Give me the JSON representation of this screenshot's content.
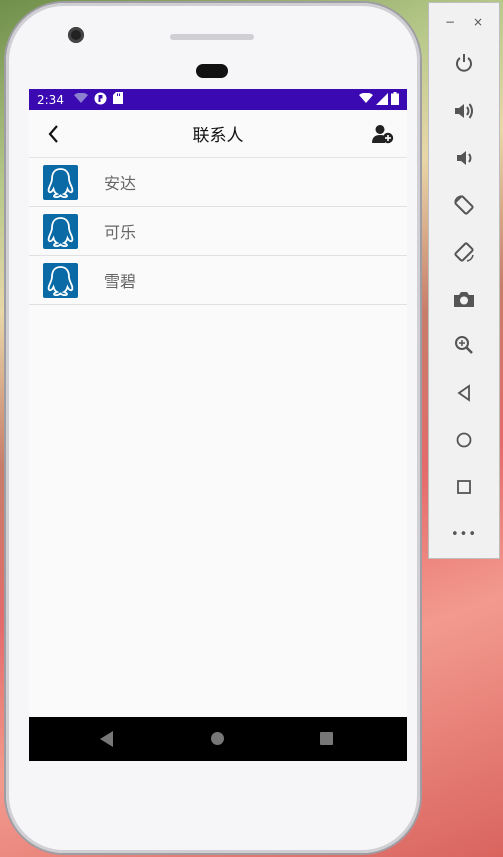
{
  "status_bar": {
    "time": "2:34"
  },
  "toolbar": {
    "title": "联系人"
  },
  "contacts": [
    {
      "name": "安达"
    },
    {
      "name": "可乐"
    },
    {
      "name": "雪碧"
    }
  ],
  "emulator_panel": {
    "minimize_label": "−",
    "close_label": "×",
    "more_label": "•••"
  },
  "colors": {
    "status_bar": "#3a09b2",
    "avatar_bg": "#0a6aa6",
    "nav_bar": "#000000"
  },
  "icons": [
    "back-arrow-icon",
    "add-contact-icon",
    "qq-penguin-icon",
    "power-icon",
    "volume-up-icon",
    "volume-down-icon",
    "rotate-left-icon",
    "rotate-right-icon",
    "camera-icon",
    "zoom-icon",
    "nav-back-icon",
    "nav-home-icon",
    "nav-recent-icon"
  ]
}
